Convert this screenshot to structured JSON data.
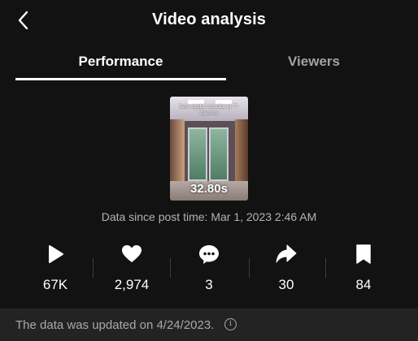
{
  "header": {
    "title": "Video analysis"
  },
  "tabs": [
    {
      "label": "Performance",
      "active": true
    },
    {
      "label": "Viewers",
      "active": false
    }
  ],
  "video": {
    "caption": "late night snacks at 7-eleven",
    "duration": "32.80s"
  },
  "post_time": "Data since post time: Mar 1, 2023 2:46 AM",
  "stats": [
    {
      "icon": "play-icon",
      "value": "67K"
    },
    {
      "icon": "heart-icon",
      "value": "2,974"
    },
    {
      "icon": "comment-icon",
      "value": "3"
    },
    {
      "icon": "share-icon",
      "value": "30"
    },
    {
      "icon": "bookmark-icon",
      "value": "84"
    }
  ],
  "footer": {
    "text": "The data was updated on 4/24/2023."
  },
  "colors": {
    "background": "#121212",
    "footer_background": "#232323",
    "text_primary": "#ffffff",
    "text_secondary": "#a9a9a9"
  }
}
